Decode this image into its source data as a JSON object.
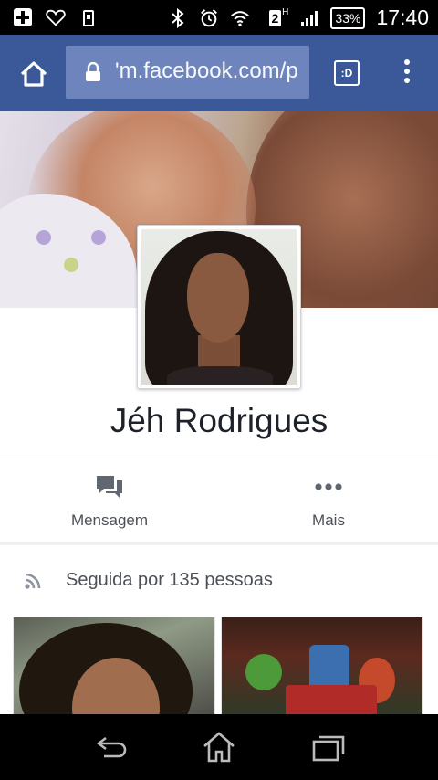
{
  "status_bar": {
    "signal_superscript": "H",
    "sim_label": "2",
    "battery": "33%",
    "time": "17:40"
  },
  "browser": {
    "url": "'m.facebook.com/p",
    "tab_button_label": ":D"
  },
  "profile": {
    "name": "Jéh Rodrigues"
  },
  "actions": [
    {
      "label": "Mensagem",
      "icon": "message-icon"
    },
    {
      "label": "Mais",
      "icon": "more-dots-icon"
    }
  ],
  "followers": {
    "text": "Seguida por 135 pessoas",
    "icon": "rss-icon"
  },
  "colors": {
    "facebook_blue": "#3b5998",
    "url_box": "#6d85bc",
    "text_dark": "#1d2129",
    "text_muted": "#4b4f56",
    "icon_grey": "#616770"
  }
}
